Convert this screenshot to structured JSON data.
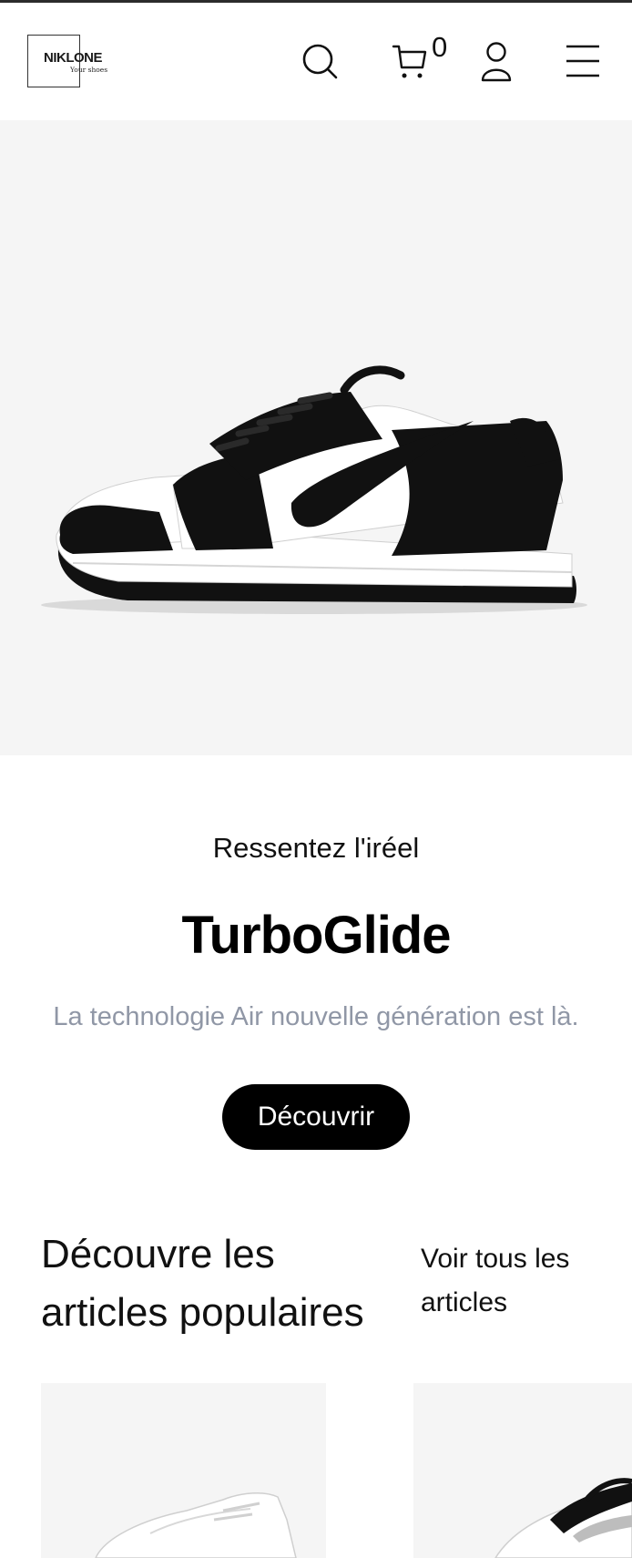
{
  "header": {
    "logo_brand": "NIKLONE",
    "logo_tagline": "Your shoes",
    "cart_count": "0",
    "icons": [
      "search-icon",
      "cart-icon",
      "user-icon",
      "menu-icon"
    ]
  },
  "hero": {
    "tagline": "Ressentez l'iréel",
    "product_name": "TurboGlide",
    "subtitle": "La technologie Air nouvelle génération est là.",
    "cta_label": "Découvrir"
  },
  "popular": {
    "title": "Découvre les articles populaires",
    "see_all": "Voir tous les articles"
  },
  "colors": {
    "accent": "#000000",
    "hero_bg": "#f5f5f5",
    "subtitle": "#9097a6"
  }
}
